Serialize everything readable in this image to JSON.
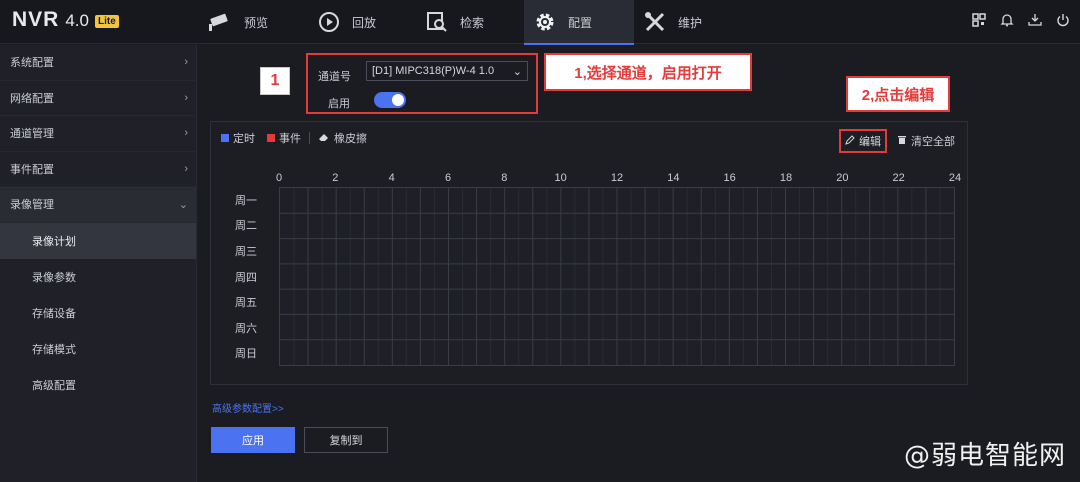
{
  "header": {
    "logo": {
      "name": "NVR",
      "version": "4.0",
      "edition": "Lite"
    },
    "nav": [
      {
        "label": "预览",
        "icon": "camera-icon"
      },
      {
        "label": "回放",
        "icon": "playback-icon"
      },
      {
        "label": "检索",
        "icon": "search-icon"
      },
      {
        "label": "配置",
        "icon": "gear-icon",
        "active": true
      },
      {
        "label": "维护",
        "icon": "tools-icon"
      }
    ],
    "right_icons": [
      "qr-code-icon",
      "bell-icon",
      "download-icon",
      "power-icon"
    ]
  },
  "sidebar": {
    "items": [
      {
        "label": "系统配置"
      },
      {
        "label": "网络配置"
      },
      {
        "label": "通道管理"
      },
      {
        "label": "事件配置"
      },
      {
        "label": "录像管理",
        "expanded": true
      }
    ],
    "subitems": [
      {
        "label": "录像计划",
        "active": true
      },
      {
        "label": "录像参数"
      },
      {
        "label": "存储设备"
      },
      {
        "label": "存储模式"
      },
      {
        "label": "高级配置"
      }
    ]
  },
  "channel": {
    "label": "通道号",
    "selected": "[D1] MIPC318(P)W-4 1.0",
    "enable_label": "启用",
    "enabled": true
  },
  "annotations": {
    "step1_num": "1",
    "step1_text": "1,选择通道，启用打开",
    "step2_num": "2",
    "step2_text": "2,点击编辑"
  },
  "schedule": {
    "legend": [
      {
        "label": "定时",
        "color": "#4b72f0"
      },
      {
        "label": "事件",
        "color": "#e53a3a"
      },
      {
        "label": "橡皮擦",
        "icon": "eraser-icon"
      }
    ],
    "edit_label": "编辑",
    "clear_label": "清空全部",
    "hours": [
      "0",
      "2",
      "4",
      "6",
      "8",
      "10",
      "12",
      "14",
      "16",
      "18",
      "20",
      "22",
      "24"
    ],
    "days": [
      "周一",
      "周二",
      "周三",
      "周四",
      "周五",
      "周六",
      "周日"
    ]
  },
  "footer": {
    "advanced_link": "高级参数配置>>",
    "apply_label": "应用",
    "copy_label": "复制到"
  },
  "watermark": "@弱电智能网"
}
